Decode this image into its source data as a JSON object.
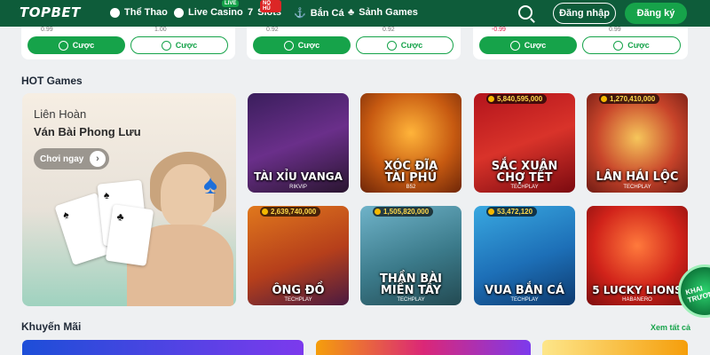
{
  "header": {
    "logo": "TOPBET",
    "nav": [
      {
        "label": "Thể Thao",
        "icon": "soccer-ball-icon"
      },
      {
        "label": "Live Casino",
        "icon": "casino-chip-icon",
        "badge": "LIVE"
      },
      {
        "label": "Slots",
        "icon": "slot-seven-icon",
        "badge": "NỔ HŨ"
      },
      {
        "label": "Bắn Cá",
        "icon": "fish-icon"
      },
      {
        "label": "Sảnh Games",
        "icon": "clover-icon"
      }
    ],
    "login_label": "Đăng nhập",
    "register_label": "Đăng ký"
  },
  "odds": {
    "card1": {
      "v1": "0.99",
      "v2": "1.00",
      "btn1": "Cược",
      "btn2": "Cược"
    },
    "card2": {
      "v1": "0.92",
      "v2": "0.92",
      "btn1": "Cược",
      "btn2": "Cược"
    },
    "card3": {
      "v1": "-0.99",
      "v2": "0.99",
      "btn1": "Cược",
      "btn2": "Cược"
    }
  },
  "hot_games": {
    "title": "HOT Games",
    "promo": {
      "line1": "Liên Hoàn",
      "line2": "Ván Bài Phong Lưu",
      "cta": "Chơi ngay"
    },
    "tiles": [
      {
        "name1": "TÀI XỈU VANGA",
        "name2": "",
        "provider": "RIKVIP",
        "jackpot": ""
      },
      {
        "name1": "XÓC ĐĨA",
        "name2": "TÀI PHÚ",
        "provider": "B52",
        "jackpot": ""
      },
      {
        "name1": "SẮC XUÂN",
        "name2": "CHỢ TẾT",
        "provider": "TECHPLAY",
        "jackpot": "5,840,595,000"
      },
      {
        "name1": "LÂN HÁI LỘC",
        "name2": "",
        "provider": "TECHPLAY",
        "jackpot": "1,270,410,000"
      },
      {
        "name1": "ÔNG ĐỒ",
        "name2": "",
        "provider": "TECHPLAY",
        "jackpot": "2,639,740,000"
      },
      {
        "name1": "THẦN BÀI",
        "name2": "MIỀN TÂY",
        "provider": "TECHPLAY",
        "jackpot": "1,505,820,000"
      },
      {
        "name1": "VUA BẮN CÁ",
        "name2": "",
        "provider": "TECHPLAY",
        "jackpot": "53,472,120"
      },
      {
        "name1": "5 LUCKY LIONS",
        "name2": "",
        "provider": "HABANERO",
        "jackpot": ""
      }
    ]
  },
  "promotions": {
    "title": "Khuyến Mãi",
    "see_all": "Xem tất cả"
  },
  "floating_badge": {
    "text": "KHAI TRƯƠNG"
  },
  "colors": {
    "brand_green": "#0e5c3a",
    "accent_green": "#16a34a",
    "jackpot_gold": "#ffd94a"
  }
}
